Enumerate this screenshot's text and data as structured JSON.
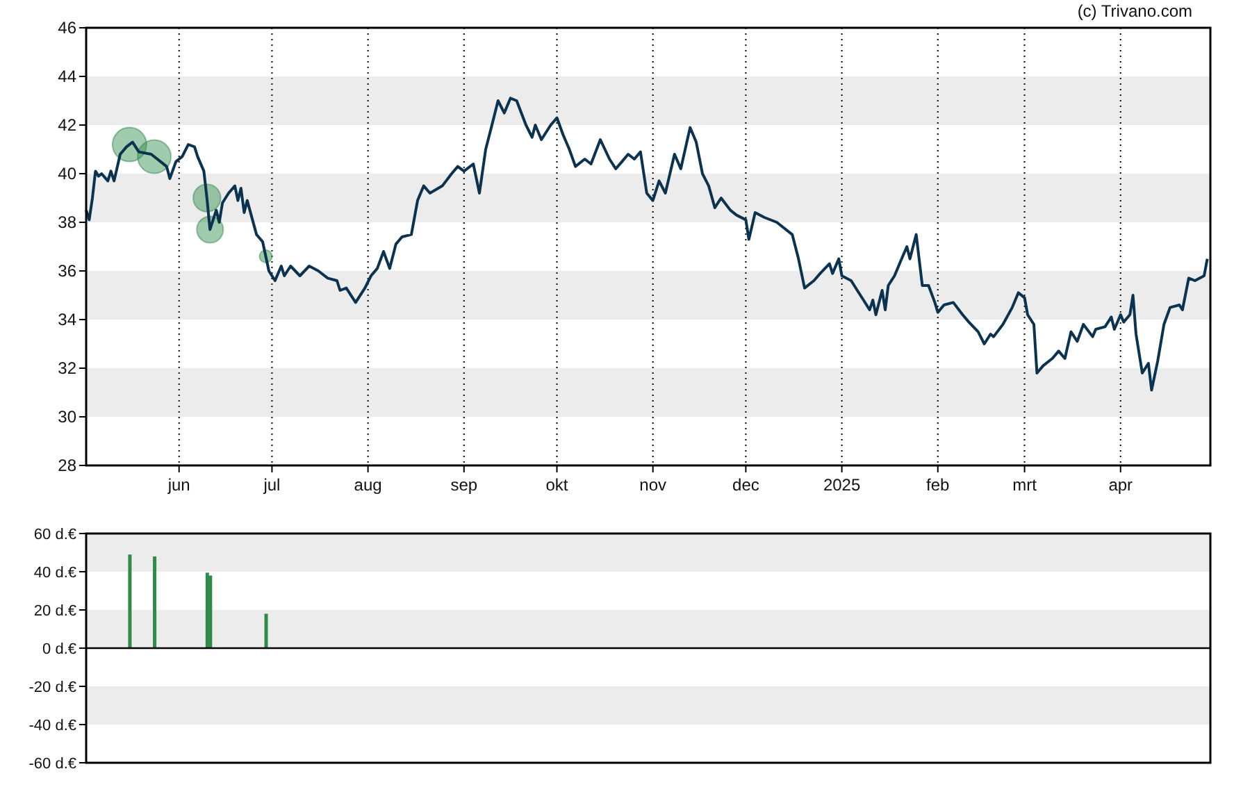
{
  "credit": "(c) Trivano.com",
  "price_chart": {
    "chart_data": {
      "type": "line",
      "xlim": [
        "2024-05-02",
        "2025-04-30"
      ],
      "ylim": [
        28,
        46
      ],
      "yticks": [
        28,
        30,
        32,
        34,
        36,
        38,
        40,
        42,
        44,
        46
      ],
      "xticks": [
        {
          "value": "2024-06-01",
          "label": "jun"
        },
        {
          "value": "2024-07-01",
          "label": "jul"
        },
        {
          "value": "2024-08-01",
          "label": "aug"
        },
        {
          "value": "2024-09-01",
          "label": "sep"
        },
        {
          "value": "2024-10-01",
          "label": "okt"
        },
        {
          "value": "2024-11-01",
          "label": "nov"
        },
        {
          "value": "2024-12-01",
          "label": "dec"
        },
        {
          "value": "2025-01-01",
          "label": "2025"
        },
        {
          "value": "2025-02-01",
          "label": "feb"
        },
        {
          "value": "2025-03-01",
          "label": "mrt"
        },
        {
          "value": "2025-04-01",
          "label": "apr"
        }
      ],
      "x": [
        "2024-05-02",
        "2024-05-03",
        "2024-05-04",
        "2024-05-05",
        "2024-05-06",
        "2024-05-07",
        "2024-05-09",
        "2024-05-10",
        "2024-05-11",
        "2024-05-13",
        "2024-05-15",
        "2024-05-17",
        "2024-05-19",
        "2024-05-23",
        "2024-05-26",
        "2024-05-28",
        "2024-05-29",
        "2024-05-31",
        "2024-06-02",
        "2024-06-04",
        "2024-06-06",
        "2024-06-07",
        "2024-06-09",
        "2024-06-10",
        "2024-06-11",
        "2024-06-13",
        "2024-06-14",
        "2024-06-15",
        "2024-06-17",
        "2024-06-19",
        "2024-06-20",
        "2024-06-21",
        "2024-06-22",
        "2024-06-23",
        "2024-06-26",
        "2024-06-28",
        "2024-06-30",
        "2024-07-02",
        "2024-07-04",
        "2024-07-05",
        "2024-07-07",
        "2024-07-10",
        "2024-07-13",
        "2024-07-16",
        "2024-07-19",
        "2024-07-22",
        "2024-07-23",
        "2024-07-25",
        "2024-07-27",
        "2024-07-28",
        "2024-07-31",
        "2024-08-02",
        "2024-08-04",
        "2024-08-06",
        "2024-08-08",
        "2024-08-10",
        "2024-08-12",
        "2024-08-15",
        "2024-08-17",
        "2024-08-19",
        "2024-08-21",
        "2024-08-25",
        "2024-08-28",
        "2024-08-30",
        "2024-09-01",
        "2024-09-04",
        "2024-09-06",
        "2024-09-08",
        "2024-09-10",
        "2024-09-12",
        "2024-09-14",
        "2024-09-16",
        "2024-09-18",
        "2024-09-21",
        "2024-09-23",
        "2024-09-24",
        "2024-09-26",
        "2024-09-29",
        "2024-10-01",
        "2024-10-03",
        "2024-10-05",
        "2024-10-07",
        "2024-10-10",
        "2024-10-12",
        "2024-10-15",
        "2024-10-18",
        "2024-10-20",
        "2024-10-22",
        "2024-10-24",
        "2024-10-26",
        "2024-10-28",
        "2024-10-30",
        "2024-11-01",
        "2024-11-03",
        "2024-11-05",
        "2024-11-08",
        "2024-11-10",
        "2024-11-13",
        "2024-11-15",
        "2024-11-17",
        "2024-11-19",
        "2024-11-21",
        "2024-11-23",
        "2024-11-26",
        "2024-11-28",
        "2024-12-01",
        "2024-12-02",
        "2024-12-04",
        "2024-12-07",
        "2024-12-11",
        "2024-12-16",
        "2024-12-18",
        "2024-12-20",
        "2024-12-23",
        "2024-12-25",
        "2024-12-28",
        "2024-12-29",
        "2024-12-31",
        "2025-01-01",
        "2025-01-04",
        "2025-01-06",
        "2025-01-08",
        "2025-01-10",
        "2025-01-11",
        "2025-01-12",
        "2025-01-14",
        "2025-01-15",
        "2025-01-16",
        "2025-01-18",
        "2025-01-20",
        "2025-01-22",
        "2025-01-23",
        "2025-01-25",
        "2025-01-27",
        "2025-01-29",
        "2025-01-31",
        "2025-02-01",
        "2025-02-03",
        "2025-02-06",
        "2025-02-09",
        "2025-02-11",
        "2025-02-14",
        "2025-02-16",
        "2025-02-18",
        "2025-02-19",
        "2025-02-22",
        "2025-02-25",
        "2025-02-27",
        "2025-03-01",
        "2025-03-02",
        "2025-03-04",
        "2025-03-05",
        "2025-03-07",
        "2025-03-10",
        "2025-03-12",
        "2025-03-14",
        "2025-03-16",
        "2025-03-18",
        "2025-03-20",
        "2025-03-23",
        "2025-03-24",
        "2025-03-27",
        "2025-03-29",
        "2025-03-30",
        "2025-04-01",
        "2025-04-02",
        "2025-04-04",
        "2025-04-05",
        "2025-04-06",
        "2025-04-08",
        "2025-04-10",
        "2025-04-11",
        "2025-04-13",
        "2025-04-15",
        "2025-04-17",
        "2025-04-20",
        "2025-04-21",
        "2025-04-23",
        "2025-04-25",
        "2025-04-28",
        "2025-04-29"
      ],
      "series": [
        {
          "color": "#0b3350",
          "values": [
            38.5,
            38.1,
            39,
            40.1,
            39.9,
            40,
            39.7,
            40.1,
            39.7,
            40.8,
            41.1,
            41.3,
            40.9,
            40.8,
            40.5,
            40.3,
            39.8,
            40.5,
            40.7,
            41.2,
            41.1,
            40.7,
            40.1,
            39,
            37.7,
            38.5,
            38,
            38.8,
            39.2,
            39.5,
            38.9,
            39.4,
            38.4,
            38.9,
            37.5,
            37.2,
            36,
            35.6,
            36.2,
            35.8,
            36.2,
            35.8,
            36.2,
            36,
            35.7,
            35.6,
            35.2,
            35.3,
            34.9,
            34.7,
            35.3,
            35.8,
            36.1,
            36.8,
            36.1,
            37.1,
            37.4,
            37.5,
            38.9,
            39.5,
            39.2,
            39.5,
            40,
            40.3,
            40.1,
            40.4,
            39.2,
            41,
            42,
            43,
            42.5,
            43.1,
            43,
            42,
            41.5,
            42,
            41.4,
            42,
            42.3,
            41.6,
            41,
            40.3,
            40.6,
            40.4,
            41.4,
            40.6,
            40.2,
            40.5,
            40.8,
            40.6,
            40.9,
            39.2,
            38.9,
            39.7,
            39.2,
            40.8,
            40.2,
            41.9,
            41.3,
            40,
            39.5,
            38.6,
            39,
            38.5,
            38.3,
            38.1,
            37.3,
            38.4,
            38.2,
            38,
            37.5,
            36.5,
            35.3,
            35.6,
            35.9,
            36.3,
            35.9,
            36.5,
            35.8,
            35.6,
            35.2,
            34.8,
            34.4,
            34.8,
            34.2,
            35.2,
            34.4,
            35.4,
            35.8,
            36.4,
            37,
            36.5,
            37.5,
            35.4,
            35.4,
            34.7,
            34.3,
            34.6,
            34.7,
            34.2,
            33.9,
            33.5,
            33,
            33.4,
            33.3,
            33.8,
            34.5,
            35.1,
            34.9,
            34.2,
            33.8,
            31.8,
            32.1,
            32.4,
            32.7,
            32.4,
            33.5,
            33.1,
            33.8,
            33.3,
            33.6,
            33.7,
            34.1,
            33.6,
            34.2,
            33.9,
            34.2,
            35,
            33.4,
            31.8,
            32.2,
            31.1,
            32.3,
            33.8,
            34.5,
            34.6,
            34.4,
            35.7,
            35.6,
            35.8,
            36.5
          ]
        }
      ],
      "grid": true
    }
  },
  "transactions_chart": {
    "chart_data": {
      "type": "bar",
      "xlim": [
        "2024-05-02",
        "2025-04-30"
      ],
      "ylim": [
        -60,
        60
      ],
      "yticks": [
        {
          "value": 60,
          "label": "60 d.€"
        },
        {
          "value": 40,
          "label": "40 d.€"
        },
        {
          "value": 20,
          "label": "20 d.€"
        },
        {
          "value": 0,
          "label": "0 d.€"
        },
        {
          "value": -20,
          "label": "-20 d.€"
        },
        {
          "value": -40,
          "label": "-40 d.€"
        },
        {
          "value": -60,
          "label": "-60 d.€"
        }
      ],
      "x": [
        "2024-05-16",
        "2024-05-24",
        "2024-06-10",
        "2024-06-11",
        "2024-06-29"
      ],
      "series": [
        {
          "color": "#2e8b4a",
          "values": [
            49,
            48,
            39.5,
            38,
            18
          ]
        }
      ]
    }
  }
}
